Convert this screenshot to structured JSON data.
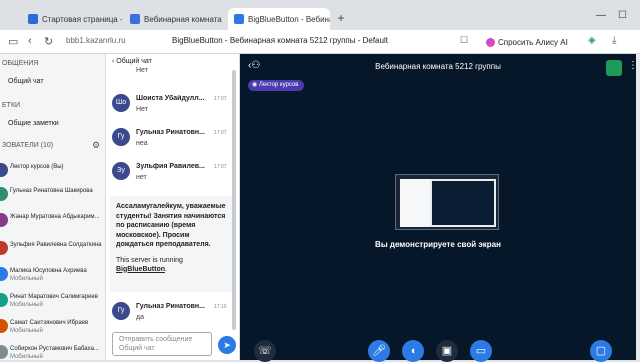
{
  "browser": {
    "tabs": [
      {
        "label": "Стартовая страница - ви",
        "color": "#2b6bd8"
      },
      {
        "label": "Вебинарная комната 5212",
        "color": "#3b6fe0"
      },
      {
        "label": "BigBlueButton - Вебинар",
        "color": "#2c7be5"
      }
    ],
    "new_tab": "+",
    "url": "bbb1.kazanrlu.ru",
    "page_title": "BigBlueButton - Вебинарная комната 5212 группы - Default",
    "alisa": "Спросить Алису AI"
  },
  "sidebar": {
    "messages_head": "ОБЩЕНИЯ",
    "public_chat": "Общий чат",
    "notes_head": "ЕТКИ",
    "shared_notes": "Общие заметки",
    "users_head": "ЗОВАТЕЛИ (10)",
    "users": [
      {
        "name": "Лектор курсов (Вы)",
        "sub": "",
        "color": "#3a4a8c"
      },
      {
        "name": "Гульназ Ринатовна Шакирова",
        "sub": "",
        "color": "#2f8f6f"
      },
      {
        "name": "Жанар Муратовна Абдыкарим...",
        "sub": "",
        "color": "#8a3a8c"
      },
      {
        "name": "Зульфия Равилевна Солдаткина",
        "sub": "",
        "color": "#c0392b"
      },
      {
        "name": "Малика Юсуповна Ахриева",
        "sub": "Мобильный",
        "color": "#2c7be5"
      },
      {
        "name": "Ринат Маратович Салимгареев",
        "sub": "Мобильный",
        "color": "#16a085"
      },
      {
        "name": "Самат Саитзянович Ибраев",
        "sub": "Мобильный",
        "color": "#d35400"
      },
      {
        "name": "Собирхон Рустамович Бабаха...",
        "sub": "Мобильный",
        "color": "#7f8c8d"
      }
    ]
  },
  "chat": {
    "title": "Общий чат",
    "messages": [
      {
        "initials": "",
        "name": "",
        "time": "",
        "text": "Нет"
      },
      {
        "initials": "Шо",
        "name": "Шоиста Убайдулл...",
        "time": "17:07",
        "text": "Нет"
      },
      {
        "initials": "Гу",
        "name": "Гульназ Ринатовн...",
        "time": "17:07",
        "text": "неа"
      },
      {
        "initials": "Зу",
        "name": "Зульфия Равилев...",
        "time": "17:07",
        "text": "нет"
      },
      {
        "initials": "Гу",
        "name": "Гульназ Ринатовн...",
        "time": "17:10",
        "text": "да"
      }
    ],
    "welcome_bold": "Ассаламугалейкум, уважаемые студенты! Занятия начинаются по расписанию (время московское). Просим дождаться преподавателя.",
    "welcome_note": "This server is running",
    "welcome_link": "BigBlueButton",
    "welcome_end": ".",
    "compose_placeholder": "Отправить сообщение Общий чат"
  },
  "main": {
    "room_title": "Вебинарная комната 5212 группы",
    "presenter_badge": "Лектор курсов",
    "share_caption": "Вы демонстрируете свой экран"
  }
}
